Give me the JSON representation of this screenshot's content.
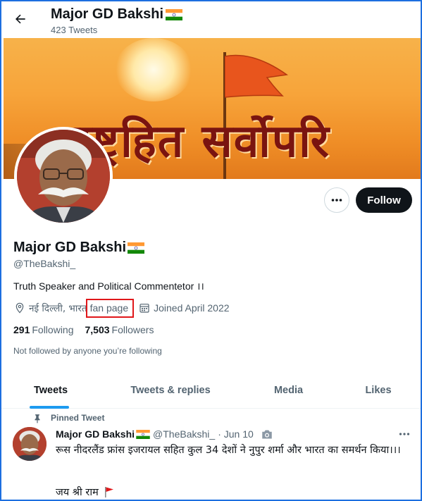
{
  "header": {
    "name": "Major GD Bakshi",
    "tweet_count": "423 Tweets"
  },
  "banner": {
    "text": "राष्ट्रहित सर्वोपरि"
  },
  "actions": {
    "follow_label": "Follow"
  },
  "profile": {
    "name": "Major GD Bakshi",
    "handle": "@TheBakshi_",
    "bio": "Truth Speaker and Political Commentetor ।।",
    "location": "नई दिल्ली, भारत",
    "website": "fan page",
    "joined": "Joined April 2022",
    "following_count": "291",
    "following_label": "Following",
    "followers_count": "7,503",
    "followers_label": "Followers",
    "not_followed": "Not followed by anyone you’re following"
  },
  "tabs": [
    {
      "label": "Tweets",
      "active": true
    },
    {
      "label": "Tweets & replies",
      "active": false
    },
    {
      "label": "Media",
      "active": false
    },
    {
      "label": "Likes",
      "active": false
    }
  ],
  "pinned_tweet": {
    "pinned_label": "Pinned Tweet",
    "author": "Major GD Bakshi",
    "handle": "@TheBakshi_",
    "date": "· Jun 10",
    "text": "रूस नीदरलैंड फ्रांस इजरायल सहित कुल 34 देशों ने नुपुर शर्मा और भारत का समर्थन किया।।।",
    "text2": "जय श्री राम"
  },
  "colors": {
    "accent": "#1d9bf0",
    "follow_bg": "#0f1419",
    "highlight_box": "#e0171a",
    "frame": "#1d6fe0"
  },
  "icons": {
    "back": "arrow-left-icon",
    "more": "ellipsis-icon",
    "location": "location-pin-icon",
    "calendar": "calendar-icon",
    "pin": "pin-icon",
    "camera": "camera-icon",
    "flag_india": "india-flag-icon",
    "red_flag": "red-flag-icon"
  }
}
